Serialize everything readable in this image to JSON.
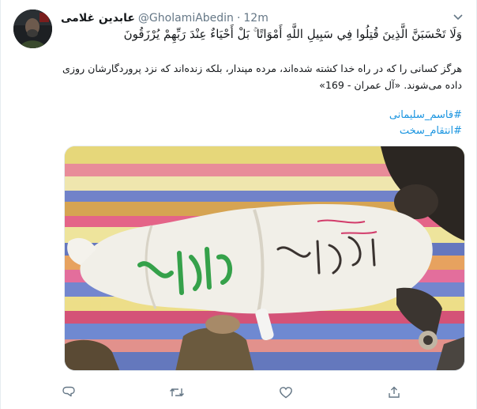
{
  "tweet": {
    "display_name": "عابدین غلامی",
    "handle": "@GholamiAbedin",
    "separator": "·",
    "time": "12m",
    "quran_verse": "وَلَا تَحْسَبَنَّ الَّذِينَ قُتِلُوا فِي سَبِيلِ اللَّهِ أَمْوَاتًا ۚ بَلْ أَحْيَاءٌ عِنْدَ رَبِّهِمْ يُرْزَقُونَ",
    "translation_line1": "هرگز کسانی را که در راه خدا کشته شده‌اند، مرده مپندار، بلکه زنده‌اند که نزد پروردگارشان روزی",
    "translation_line2": "داده می‌شوند. «آل عمران - 169»",
    "hashtags": [
      "#قاسم_سلیمانی",
      "#انتقام_سخت"
    ]
  },
  "icons": {
    "avatar": "profile-photo",
    "caret": "chevron-down-icon",
    "reply": "reply-icon",
    "retweet": "retweet-icon",
    "like": "heart-icon",
    "share": "share-icon"
  },
  "colors": {
    "link": "#1b95e0",
    "secondary": "#657786",
    "primary_text": "#14171a"
  }
}
